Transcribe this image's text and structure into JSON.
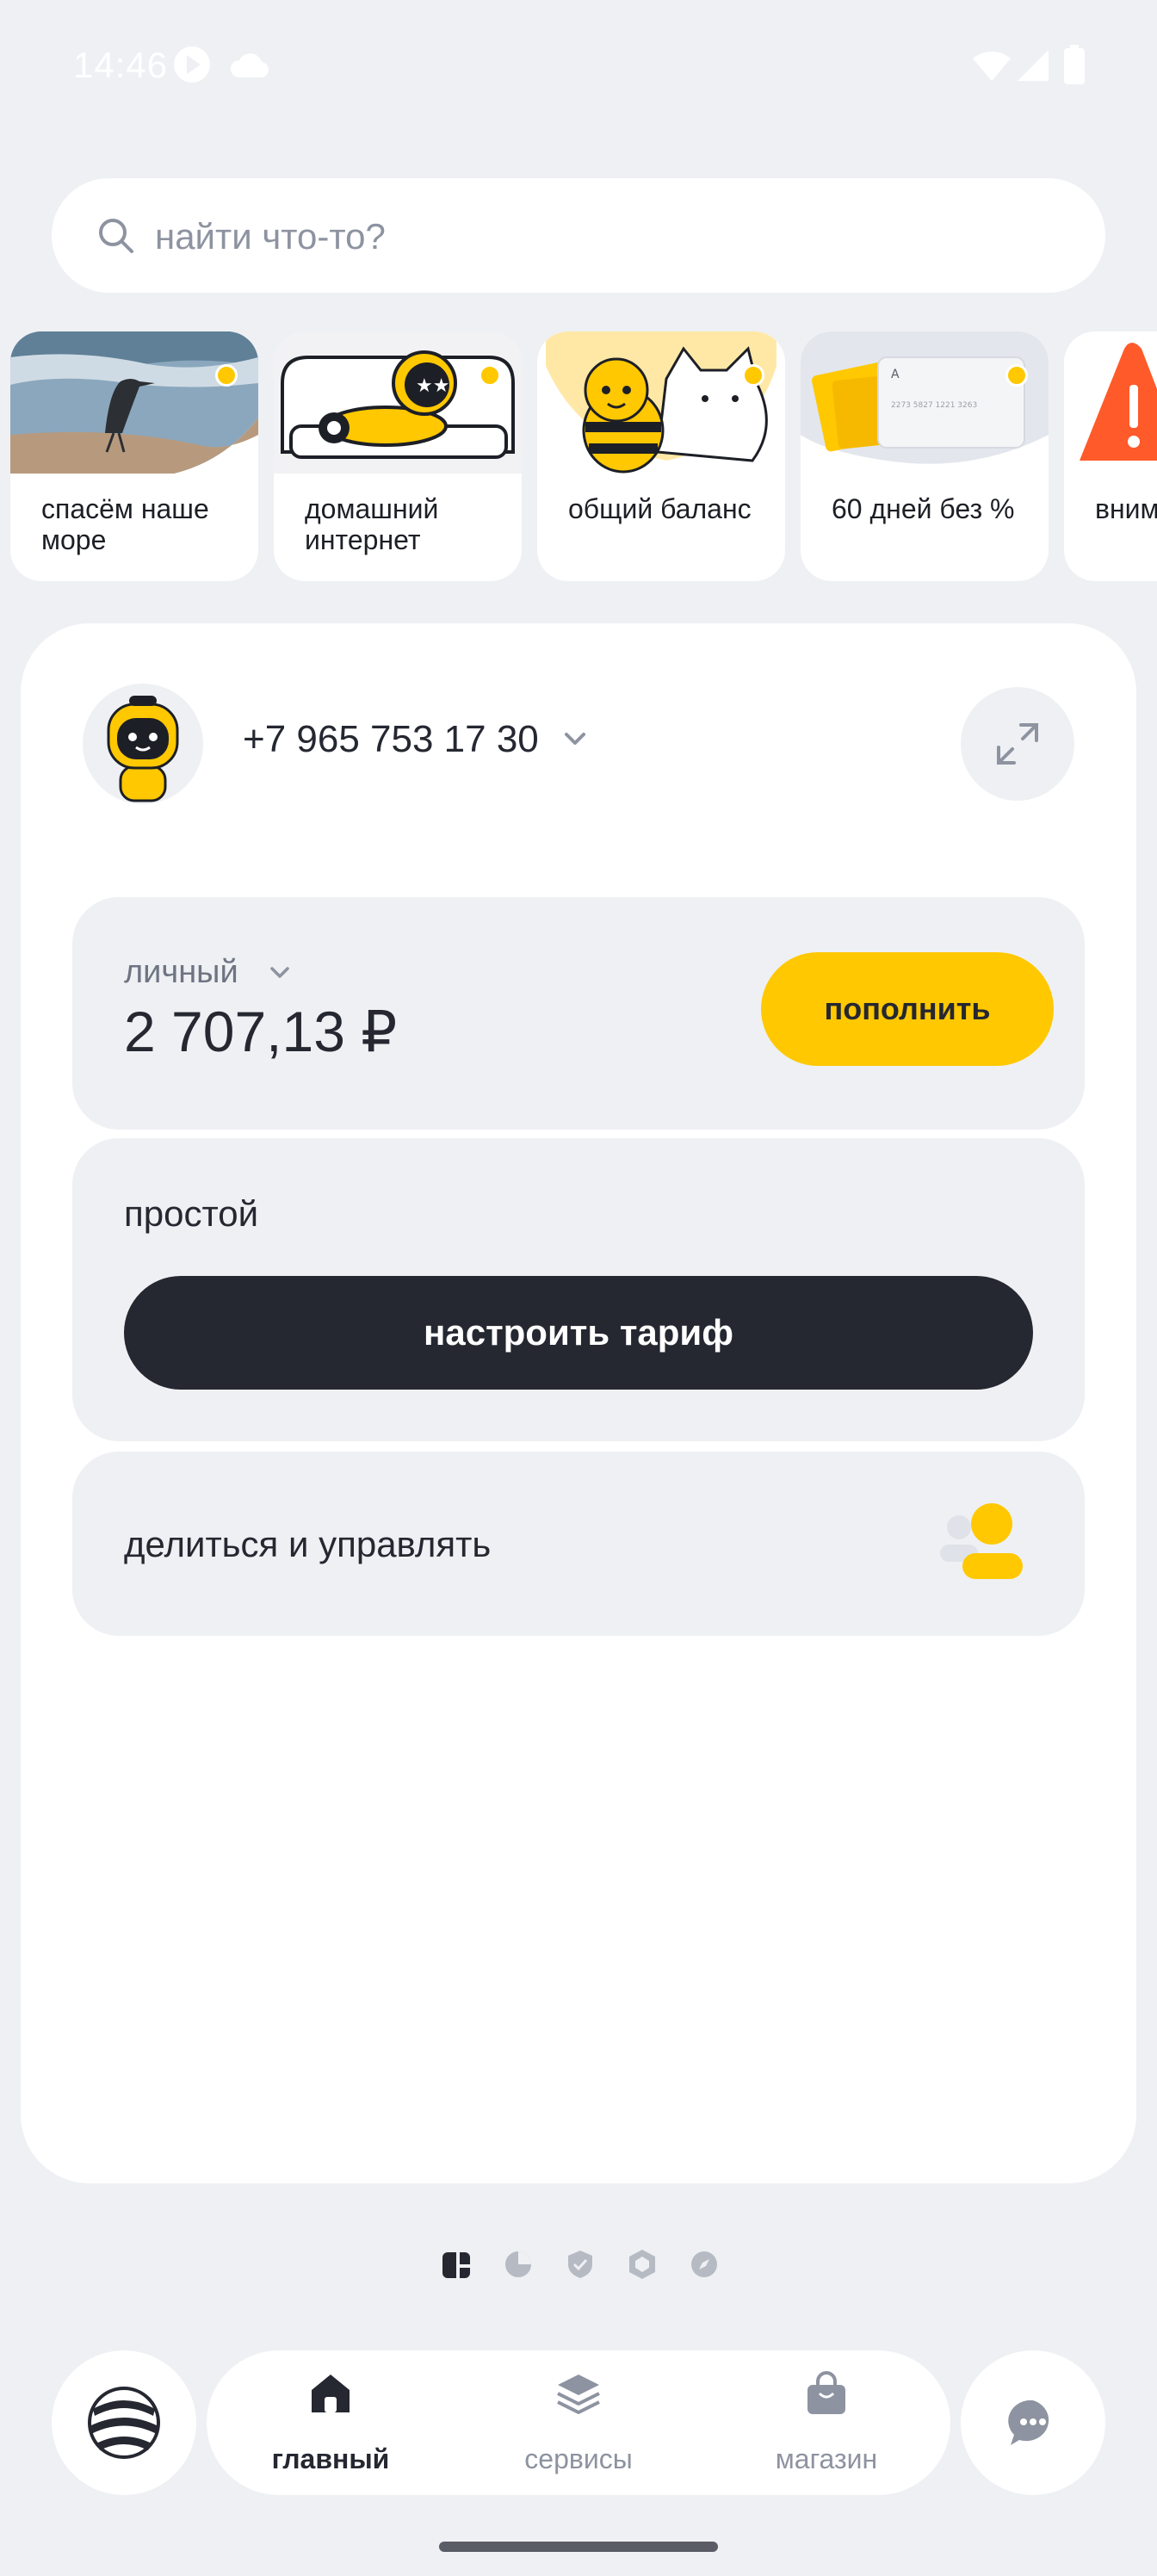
{
  "status_bar": {
    "time": "14:46",
    "icons": [
      "play-icon",
      "cloud-icon",
      "wifi-icon",
      "signal-icon",
      "battery-icon"
    ]
  },
  "search": {
    "placeholder": "найти что-то?"
  },
  "stories": [
    {
      "title": "спасём наше море",
      "icon": "heron-photo"
    },
    {
      "title": "домашний интернет",
      "icon": "robot-on-sofa"
    },
    {
      "title": "общий баланс",
      "icon": "bee-and-cat"
    },
    {
      "title": "60 дней без %",
      "icon": "bank-card"
    },
    {
      "title": "вним мош",
      "icon": "warning-icon"
    }
  ],
  "account": {
    "phone": "+7 965 753 17 30",
    "balance_label": "личный",
    "balance": "2 707,13 ₽",
    "topup_label": "пополнить",
    "tariff_name": "простой",
    "tariff_button_label": "настроить тариф",
    "share_label": "делиться и управлять"
  },
  "page_indicators": {
    "count": 5,
    "active_index": 0,
    "icons": [
      "cards-icon",
      "pie-chart-icon",
      "shield-icon",
      "hexagon-icon",
      "compass-icon"
    ]
  },
  "nav": {
    "items": [
      {
        "label": "главный",
        "icon": "home-icon",
        "active": true
      },
      {
        "label": "сервисы",
        "icon": "layers-icon",
        "active": false
      },
      {
        "label": "магазин",
        "icon": "shopping-bag-icon",
        "active": false
      }
    ]
  },
  "colors": {
    "accent": "#ffc800",
    "dark": "#252731",
    "background": "#eef0f3",
    "muted": "#8d93a0"
  }
}
